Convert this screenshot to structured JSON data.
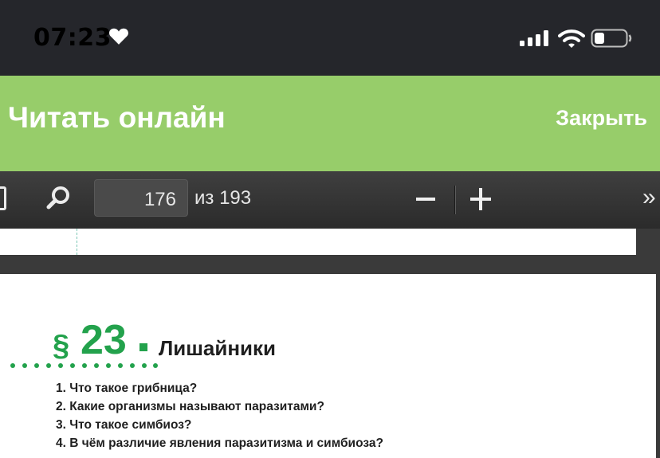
{
  "status_bar": {
    "time": "07:23",
    "icons": [
      "heart-icon",
      "signal-icon",
      "wifi-icon",
      "battery-icon"
    ],
    "text_color": "#ffffff",
    "background": "#25262b"
  },
  "header": {
    "title": "Читать онлайн",
    "close_label": "Закрыть",
    "background": "#97cd6a"
  },
  "pdf_toolbar": {
    "current_page": "176",
    "page_total_label": "из 193",
    "zoom_out_icon": "minus-icon",
    "zoom_in_icon": "plus-icon",
    "more_tools_label": "»",
    "icons": [
      "sidebar-toggle-icon",
      "search-icon"
    ]
  },
  "document": {
    "section_mark": "§",
    "section_number": "23",
    "section_title": "Лишайники",
    "accent_color": "#23a24c",
    "questions": [
      "1. Что такое грибница?",
      "2. Какие организмы называют паразитами?",
      "3. Что такое симбиоз?",
      "4. В чём различие явления паразитизма и симбиоза?"
    ]
  }
}
